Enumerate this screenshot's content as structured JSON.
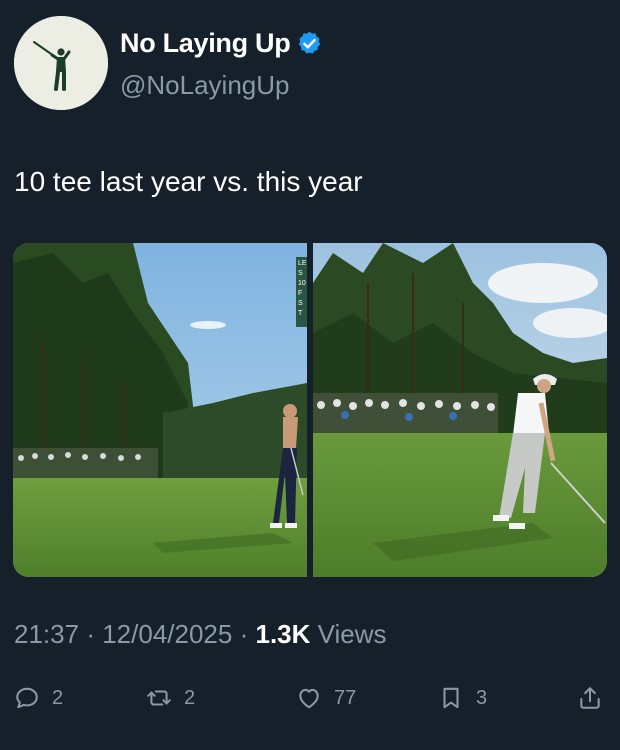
{
  "author": {
    "display_name": "No Laying Up",
    "handle": "@NoLayingUp",
    "verified": true,
    "avatar_icon": "golfer-silhouette-logo"
  },
  "tweet": {
    "text": "10 tee last year vs. this year"
  },
  "media": {
    "panels": [
      {
        "name": "last-year-tee-shot",
        "overlay_text": [
          "LE",
          "S",
          "10",
          "F",
          "S",
          "T"
        ]
      },
      {
        "name": "this-year-tee-shot"
      }
    ]
  },
  "meta": {
    "time": "21:37",
    "date": "12/04/2025",
    "views_count": "1.3K",
    "views_label": "Views",
    "separator": "·"
  },
  "actions": {
    "replies": {
      "icon": "reply-icon",
      "count": "2"
    },
    "retweets": {
      "icon": "retweet-icon",
      "count": "2"
    },
    "likes": {
      "icon": "heart-icon",
      "count": "77"
    },
    "bookmarks": {
      "icon": "bookmark-icon",
      "count": "3"
    },
    "share": {
      "icon": "share-icon"
    }
  },
  "colors": {
    "background": "#15202b",
    "text": "#ffffff",
    "secondary_text": "#8b98a5",
    "verified_badge": "#1d9bf0"
  }
}
